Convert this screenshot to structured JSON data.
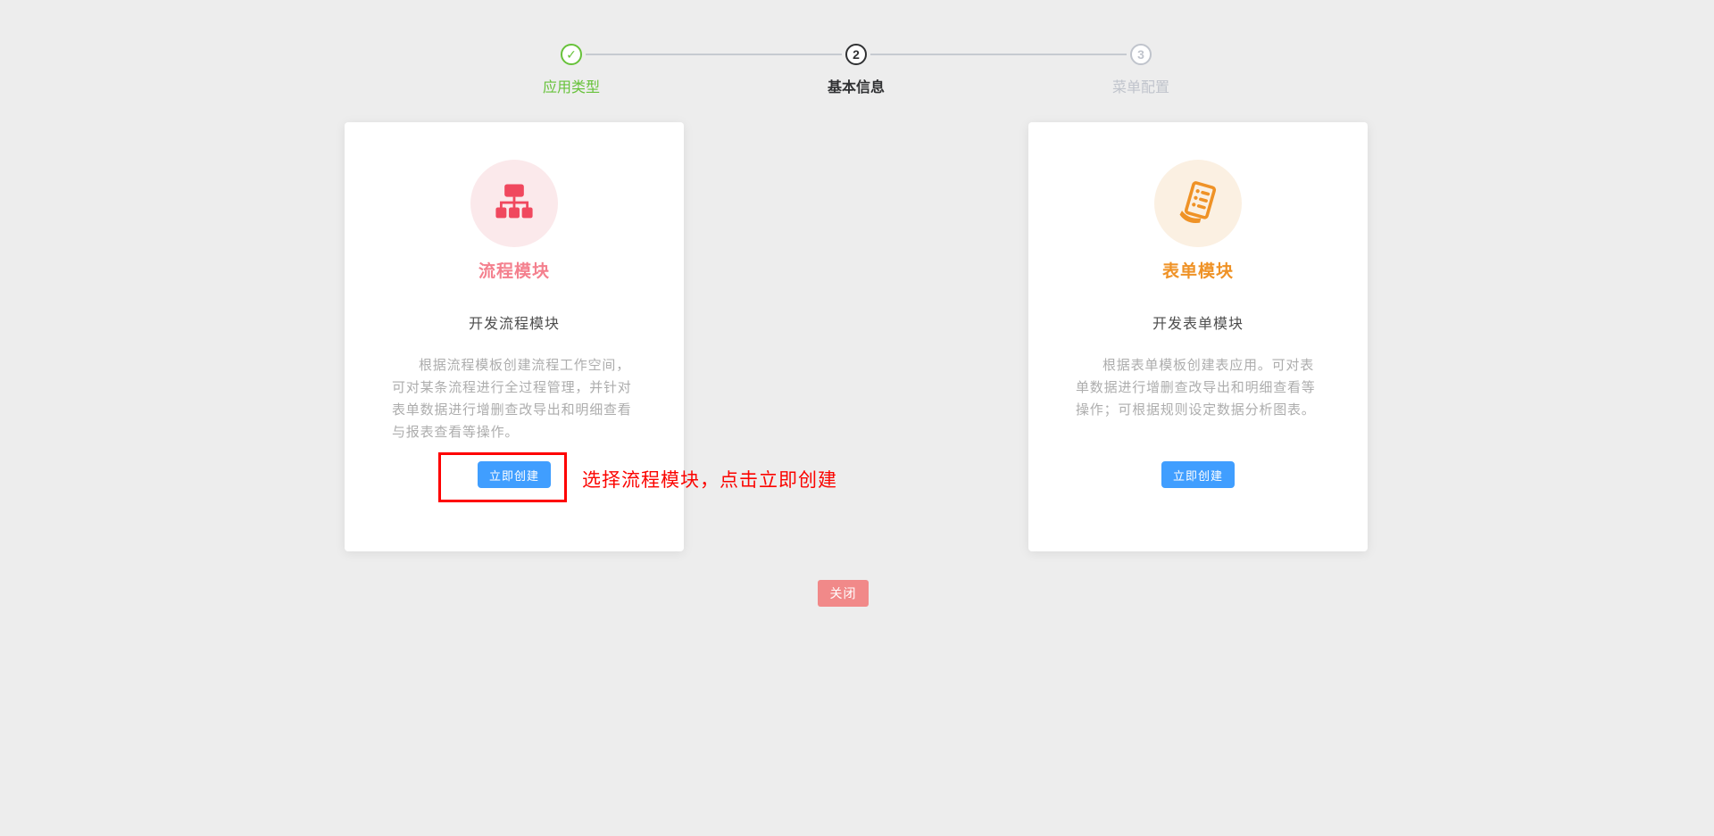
{
  "page": {
    "background_color": "#ededed"
  },
  "stepper": {
    "steps": [
      {
        "label": "应用类型",
        "status": "finished",
        "icon_glyph": "✓",
        "color": "#67c23a"
      },
      {
        "label": "基本信息",
        "status": "process",
        "number": "2",
        "color": "#303133"
      },
      {
        "label": "菜单配置",
        "status": "wait",
        "number": "3",
        "color": "#c0c4cc"
      }
    ],
    "connector_color": "#c6cad1"
  },
  "cards": [
    {
      "id": "flow-module",
      "icon": "flowchart-icon",
      "icon_color": "#f0485e",
      "icon_bg": "#fbe9eb",
      "title": "流程模块",
      "title_color": "#f4808e",
      "subtitle": "开发流程模块",
      "desc_lines": [
        "根据流程模板创建流程工作空间，",
        "可对某条流程进行全过程管理，并针对",
        "表单数据进行增删查改导出和明细查看",
        "与报表查看等操作。"
      ],
      "button_label": "立即创建",
      "button_color": "#409eff"
    },
    {
      "id": "form-module",
      "icon": "form-sheet-icon",
      "icon_color": "#ef9226",
      "icon_bg": "#fbf0e2",
      "title": "表单模块",
      "title_color": "#ef9226",
      "subtitle": "开发表单模块",
      "desc_lines": [
        "根据表单模板创建表应用。可对表",
        "单数据进行增删查改导出和明细查看等",
        "操作；可根据规则设定数据分析图表。"
      ],
      "button_label": "立即创建",
      "button_color": "#409eff"
    }
  ],
  "annotation": {
    "text": "选择流程模块，点击立即创建",
    "color": "#fb0400",
    "box_color": "#fe0000"
  },
  "footer": {
    "close_label": "关闭",
    "close_color": "#f18989"
  }
}
